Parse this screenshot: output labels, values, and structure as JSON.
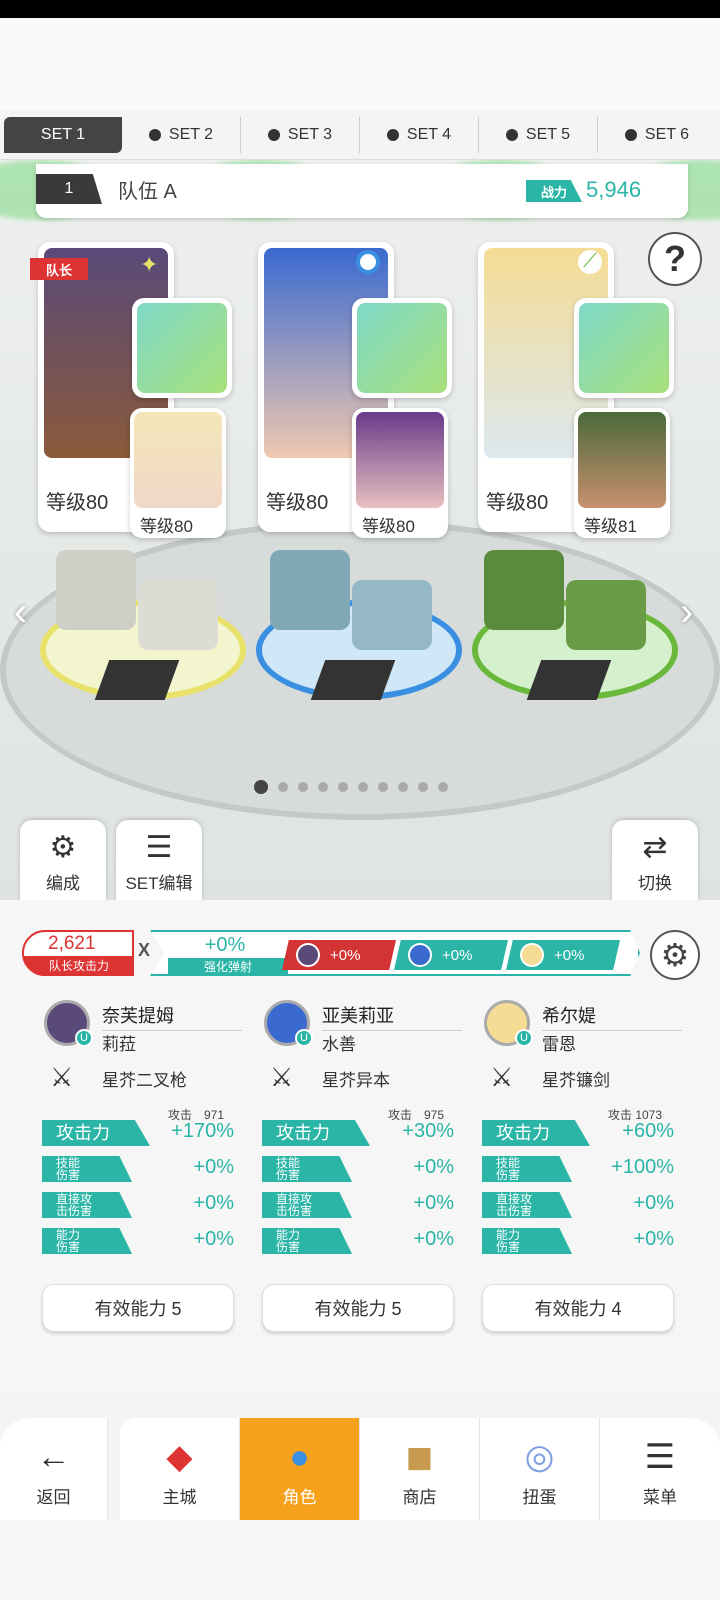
{
  "sets": [
    {
      "label": "SET 1",
      "active": true
    },
    {
      "label": "SET 2",
      "active": false
    },
    {
      "label": "SET 3",
      "active": false
    },
    {
      "label": "SET 4",
      "active": false
    },
    {
      "label": "SET 5",
      "active": false
    },
    {
      "label": "SET 6",
      "active": false
    }
  ],
  "team": {
    "number": "1",
    "name": "队伍 A",
    "power_label": "战力",
    "power": "5,946"
  },
  "leader_label": "队长",
  "characters": [
    {
      "level": "等级80",
      "sub_level": "等级80",
      "accent": "#e8e26a"
    },
    {
      "level": "等级80",
      "sub_level": "等级80",
      "accent": "#3b8fe3"
    },
    {
      "level": "等级80",
      "sub_level": "等级81",
      "accent": "#6ab83b"
    }
  ],
  "page_dots": 10,
  "current_page": 1,
  "buttons": {
    "formation": "编成",
    "set_edit": "SET编辑",
    "switch": "切换"
  },
  "summary": {
    "leader_attack": "2,621",
    "leader_attack_label": "队长攻击力",
    "multiplier": "X",
    "reinforce": "+0%",
    "reinforce_label": "强化弹射",
    "chips": [
      "+0%",
      "+0%",
      "+0%"
    ]
  },
  "heroes": [
    {
      "name": "奈芙提姆",
      "sub": "莉菈",
      "weapon": "星芥二叉枪",
      "attack_base": "攻击　971",
      "attack": "+170%",
      "skill": "+0%",
      "direct": "+0%",
      "ability": "+0%",
      "effective": "有效能力 5"
    },
    {
      "name": "亚美莉亚",
      "sub": "水善",
      "weapon": "星芥异本",
      "attack_base": "攻击　975",
      "attack": "+30%",
      "skill": "+0%",
      "direct": "+0%",
      "ability": "+0%",
      "effective": "有效能力 5"
    },
    {
      "name": "希尔媞",
      "sub": "雷恩",
      "weapon": "星芥镰剑",
      "attack_base": "攻击 1073",
      "attack": "+60%",
      "skill": "+100%",
      "direct": "+0%",
      "ability": "+0%",
      "effective": "有效能力 4"
    }
  ],
  "stat_labels": {
    "attack": "攻击力",
    "skill": "技能\n伤害",
    "direct": "直接攻\n击伤害",
    "ability": "能力\n伤害"
  },
  "nav": {
    "back": "返回",
    "city": "主城",
    "character": "角色",
    "shop": "商店",
    "gacha": "扭蛋",
    "menu": "菜单"
  },
  "icons": {
    "help": "question-icon",
    "gear": "gear-icon",
    "back": "arrow-left-icon"
  },
  "colors": {
    "teal": "#2ab5a6",
    "red": "#d33333",
    "active_nav": "#f5a11c"
  }
}
